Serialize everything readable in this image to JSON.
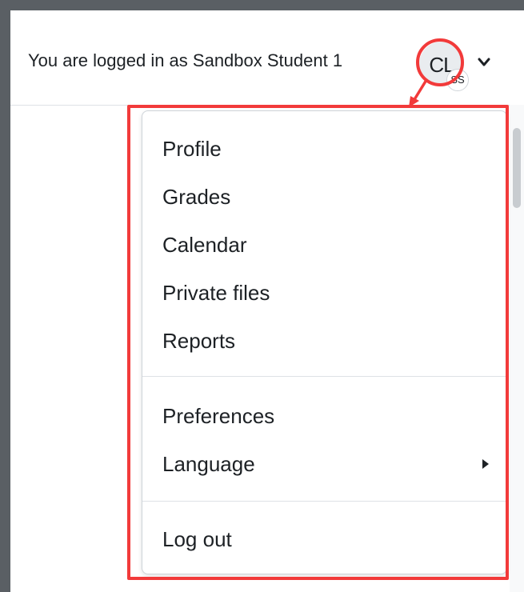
{
  "header": {
    "login_text": "You are logged in as Sandbox Student 1",
    "avatar_initials": "CL",
    "avatar_badge": "SS",
    "menu_toggle_icon": "chevron-down-icon"
  },
  "user_menu": {
    "group1": [
      {
        "label": "Profile"
      },
      {
        "label": "Grades"
      },
      {
        "label": "Calendar"
      },
      {
        "label": "Private files"
      },
      {
        "label": "Reports"
      }
    ],
    "group2": [
      {
        "label": "Preferences"
      },
      {
        "label": "Language",
        "icon": "caret-right-icon"
      }
    ],
    "group3": [
      {
        "label": "Log out"
      }
    ]
  },
  "colors": {
    "annotation": "#f23a3a",
    "text": "#1d2125",
    "avatar_bg": "#e9ecef",
    "divider": "#dee2e6",
    "frame": "#5a5f64"
  }
}
